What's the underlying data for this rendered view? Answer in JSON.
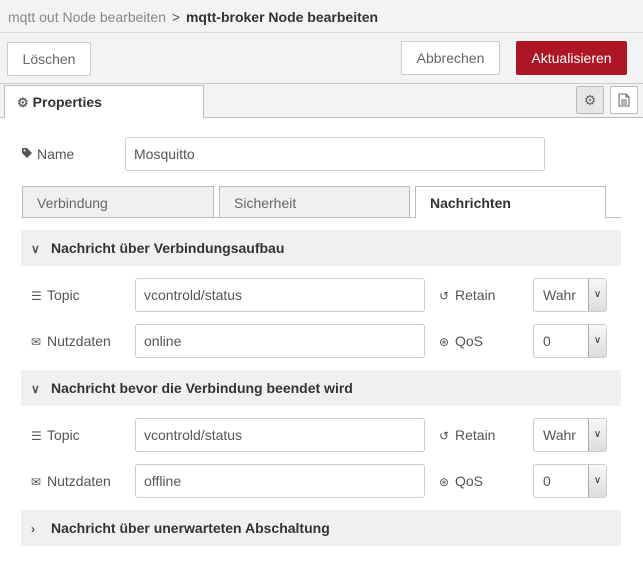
{
  "breadcrumb": {
    "parent": "mqtt out Node bearbeiten",
    "separator": ">",
    "current": "mqtt-broker Node bearbeiten"
  },
  "toolbar": {
    "delete_label": "Löschen",
    "cancel_label": "Abbrechen",
    "update_label": "Aktualisieren"
  },
  "tabs": {
    "properties_label": "Properties"
  },
  "name_field": {
    "label": "Name",
    "value": "Mosquitto"
  },
  "subtabs": [
    {
      "label": "Verbindung",
      "active": false
    },
    {
      "label": "Sicherheit",
      "active": false
    },
    {
      "label": "Nachrichten",
      "active": true
    }
  ],
  "sections": [
    {
      "title": "Nachricht über Verbindungsaufbau",
      "expanded": true,
      "topic_label": "Topic",
      "topic_value": "vcontrold/status",
      "retain_label": "Retain",
      "retain_value": "Wahr",
      "payload_label": "Nutzdaten",
      "payload_value": "online",
      "qos_label": "QoS",
      "qos_value": "0"
    },
    {
      "title": "Nachricht bevor die Verbindung beendet wird",
      "expanded": true,
      "topic_label": "Topic",
      "topic_value": "vcontrold/status",
      "retain_label": "Retain",
      "retain_value": "Wahr",
      "payload_label": "Nutzdaten",
      "payload_value": "offline",
      "qos_label": "QoS",
      "qos_value": "0"
    },
    {
      "title": "Nachricht über unerwarteten Abschaltung",
      "expanded": false
    }
  ],
  "colors": {
    "primary": "#ad1625",
    "header_bg": "#f3f3f3",
    "section_bg": "#f0f0f0"
  }
}
